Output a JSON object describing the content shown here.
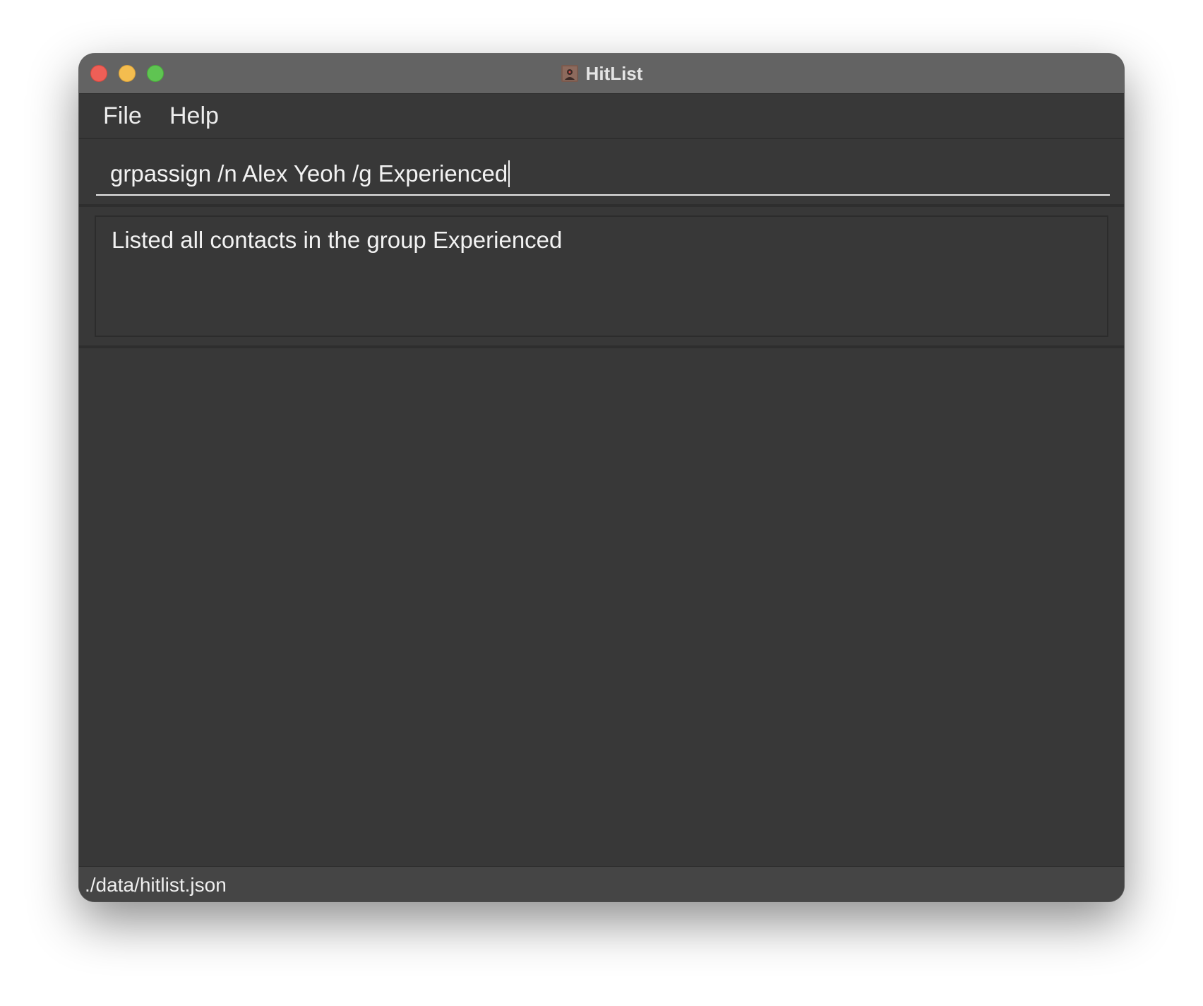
{
  "window": {
    "title": "HitList",
    "app_icon": "hitlist-app-icon"
  },
  "menubar": {
    "items": [
      {
        "label": "File"
      },
      {
        "label": "Help"
      }
    ]
  },
  "command_box": {
    "value": "grpassign /n Alex Yeoh /g Experienced"
  },
  "result_display": {
    "text": "Listed all contacts in the group Experienced"
  },
  "status_bar": {
    "save_location": "./data/hitlist.json"
  },
  "colors": {
    "titlebar": "#636363",
    "window_background": "#383838",
    "close": "#ee5f57",
    "minimize": "#f4bd4f",
    "maximize": "#5fc452"
  }
}
